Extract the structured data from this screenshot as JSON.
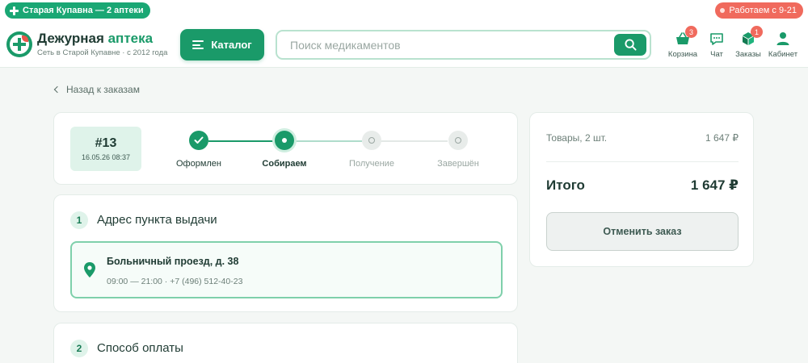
{
  "topbar": {
    "city": "Старая Купавна — 2 аптеки",
    "hours": "Работаем с 9-21"
  },
  "brand": {
    "name_part1": "Дежурная",
    "name_part2": "аптека",
    "tagline": "Сеть в Старой Купавне · с 2012 года"
  },
  "header": {
    "catalog_label": "Каталог",
    "search_placeholder": "Поиск медикаментов",
    "nav": [
      {
        "label": "Корзина",
        "icon": "basket-icon",
        "badge": "3"
      },
      {
        "label": "Чат",
        "icon": "chat-icon",
        "badge": ""
      },
      {
        "label": "Заказы",
        "icon": "box-icon",
        "badge": "1"
      },
      {
        "label": "Кабинет",
        "icon": "user-icon",
        "badge": ""
      }
    ]
  },
  "back_link": "Назад к заказам",
  "order": {
    "number": "#13",
    "datetime": "16.05.26 08:37",
    "steps": [
      {
        "label": "Оформлен",
        "state": "done"
      },
      {
        "label": "Собираем",
        "state": "active"
      },
      {
        "label": "Получение",
        "state": "todo"
      },
      {
        "label": "Завершён",
        "state": "todo"
      }
    ]
  },
  "pickup": {
    "num": "1",
    "title": "Адрес пункта выдачи",
    "address": "Больничный проезд, д. 38",
    "meta": "09:00 — 21:00 · +7 (496) 512-40-23"
  },
  "payment": {
    "num": "2",
    "title": "Способ оплаты"
  },
  "summary": {
    "items_label": "Товары, 2 шт.",
    "items_value": "1 647 ₽",
    "total_label": "Итого",
    "total_value": "1 647 ₽",
    "cancel_label": "Отменить заказ"
  },
  "colors": {
    "brand_green": "#1a9a69",
    "alert_red": "#f06a5d",
    "light_green": "#dff3ea"
  }
}
